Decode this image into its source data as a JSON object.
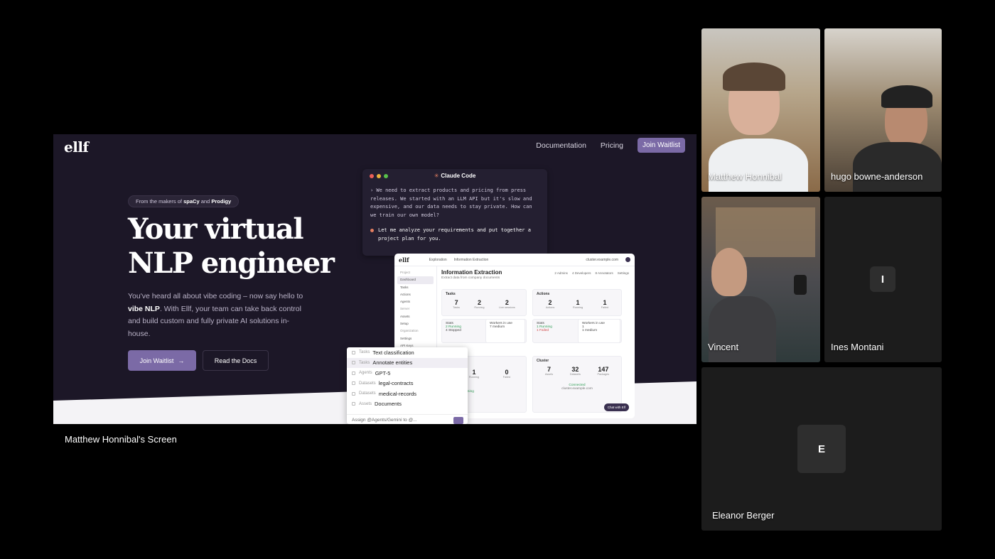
{
  "share": {
    "label": "Matthew Honnibal's Screen",
    "brand": "ellf",
    "nav": {
      "docs": "Documentation",
      "pricing": "Pricing",
      "cta": "Join Waitlist"
    },
    "pill_prefix": "From the makers of ",
    "pill_a": "spaCy",
    "pill_mid": " and ",
    "pill_b": "Prodigy",
    "title_line1": "Your virtual",
    "title_line2": "NLP engineer",
    "sub_a": "You've heard all about vibe coding – now say hello to ",
    "sub_b": "vibe NLP",
    "sub_c": ". With Ellf, your team can take back control and build custom and fully private AI solutions in-house.",
    "btn_primary": "Join Waitlist",
    "btn_secondary": "Read the Docs",
    "terminal": {
      "title": "Claude Code",
      "prompt": "› We need to extract products and pricing from press releases. We started with an LLM API but it's slow and expensive, and our data needs to stay private. How can we train our own model?",
      "answer": "Let me analyze your requirements and put together a project plan for you."
    },
    "app": {
      "logo": "ellf",
      "crumb1": "Exploration",
      "crumb2": "Information Extraction",
      "url": "cluster.example.com",
      "title": "Information Extraction",
      "subtitle": "Extract data from company documents",
      "meta": [
        "2 Admins",
        "4 Developers",
        "8 Annotators",
        "Settings"
      ],
      "side": [
        "Dashboard",
        "Tasks",
        "Actions",
        "Agents",
        "Assets",
        "Setup",
        "Settings",
        "API Keys"
      ],
      "side_groups": [
        "Project",
        "Server",
        "Organization"
      ],
      "tasks_header": "Tasks",
      "actions_header": "Actions",
      "cluster_header": "Cluster",
      "tasks_stats": [
        {
          "v": "7",
          "l": "Tasks"
        },
        {
          "v": "2",
          "l": "Running"
        },
        {
          "v": "2",
          "l": "Live sessions"
        }
      ],
      "actions_stats": [
        {
          "v": "2",
          "l": "Actions"
        },
        {
          "v": "1",
          "l": "Running"
        },
        {
          "v": "1",
          "l": "Failed"
        }
      ],
      "cluster_stats": [
        {
          "v": "7",
          "l": "Assets"
        },
        {
          "v": "32",
          "l": "Datasets"
        },
        {
          "v": "147",
          "l": "Packages"
        }
      ],
      "mid_stats": [
        {
          "v": "1",
          "l": "Running"
        },
        {
          "v": "0",
          "l": "Failed"
        }
      ],
      "stats_label": "Stats",
      "workers_label": "Workers in use",
      "row_running": "2 Running",
      "row_stopped": "4 Stopped",
      "row_medium": "7 medium",
      "row_running_b": "1 Running",
      "row_failed": "1 Failed",
      "row_one": "1",
      "row_one_medium": "1 medium",
      "row_running_c": "1 Running",
      "connected": "Connected",
      "connected_url": "cluster.example.com",
      "chat_btn": "Chat with Elf"
    },
    "dropdown": {
      "items": [
        {
          "kind": "Tasks",
          "label": "Text classification"
        },
        {
          "kind": "Tasks",
          "label": "Annotate entities"
        },
        {
          "kind": "Agents",
          "label": "GPT-5"
        },
        {
          "kind": "Datasets",
          "label": "legal-contracts"
        },
        {
          "kind": "Datasets",
          "label": "medical-records"
        },
        {
          "kind": "Assets",
          "label": "Documents"
        }
      ],
      "input": "Assign @Agents/Gemini to @..."
    }
  },
  "participants": {
    "matthew": "Matthew Honnibal",
    "hugo": "hugo bowne-anderson",
    "vincent": "Vincent",
    "ines": "Ines Montani",
    "ines_initial": "I",
    "eleanor": "Eleanor Berger",
    "eleanor_initial": "E"
  }
}
